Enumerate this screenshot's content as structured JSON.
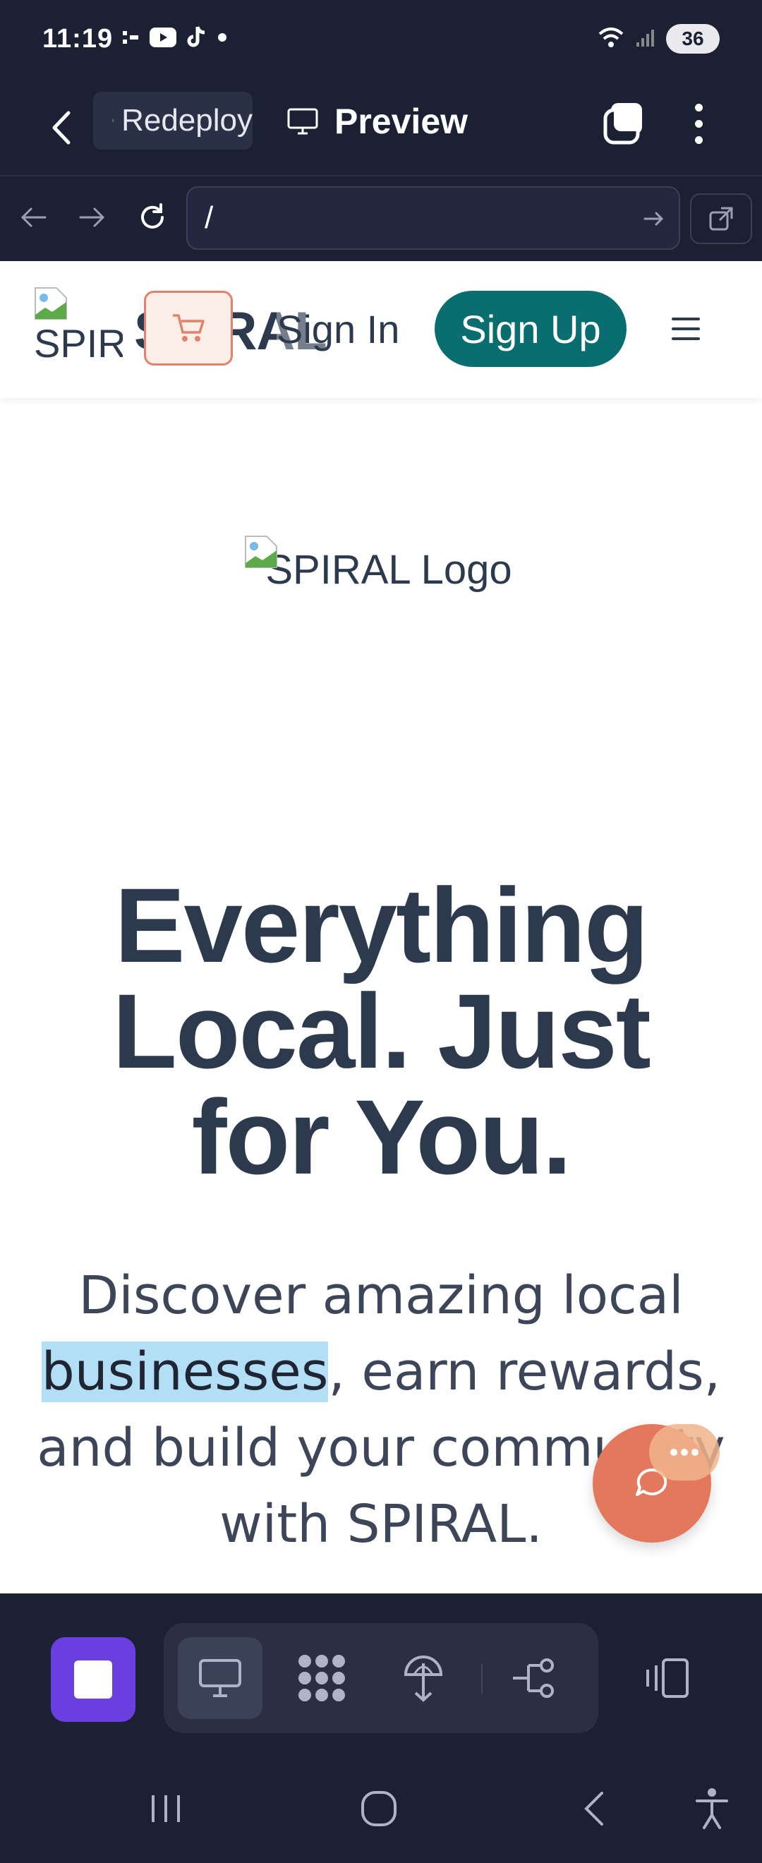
{
  "status_bar": {
    "time": "11:19",
    "battery": "36",
    "left_icons": [
      "screen-record-icon",
      "youtube-icon",
      "tiktok-icon",
      "dot-icon"
    ],
    "right_icons": [
      "wifi-icon",
      "signal-icon",
      "battery-icon"
    ]
  },
  "app_bar": {
    "chip_label": "Redeploy",
    "title": "Preview"
  },
  "url_bar": {
    "value": "/"
  },
  "site": {
    "logo_alt": "SPIRAL",
    "brand": "SPIRAL",
    "sign_in": "Sign In",
    "sign_up": "Sign Up",
    "hero_logo_alt": "SPIRAL Logo",
    "headline_lines": [
      "Everything",
      "Local. Just",
      "for You."
    ],
    "subtext_before": "Discover amazing local ",
    "subtext_highlight": "businesses",
    "subtext_after": ", earn rewards, and build your community with SPIRAL."
  },
  "colors": {
    "accent_teal": "#0a6e70",
    "cart_orange": "#e1826a",
    "chat_orange": "#e4785c",
    "app_purple": "#6a3fe0",
    "highlight": "#b2def6"
  },
  "toolbar": {
    "icons": [
      "app-square-icon",
      "desktop-icon",
      "grid-icon",
      "deploy-icon",
      "share-flow-icon",
      "device-toggle-icon"
    ]
  }
}
